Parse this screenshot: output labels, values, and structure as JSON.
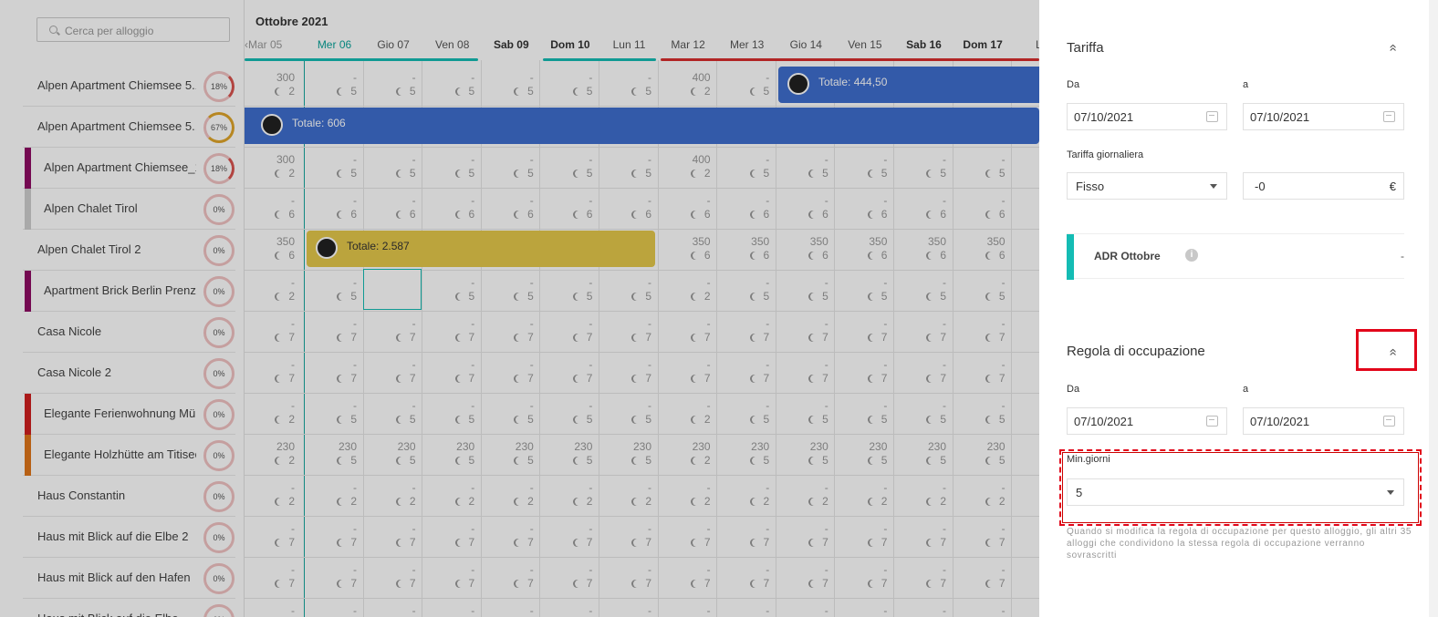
{
  "search": {
    "placeholder": "Cerca per alloggio"
  },
  "calendar": {
    "month": "Ottobre 2021",
    "prev_day": "Mar 05",
    "days": [
      "Mer 06",
      "Gio 07",
      "Ven 08",
      "Sab 09",
      "Dom 10",
      "Lun 11",
      "Mar 12",
      "Mer 13",
      "Gio 14",
      "Ven 15",
      "Sab 16",
      "Dom 17",
      "Lu"
    ]
  },
  "properties": [
    {
      "name": "Alpen Apartment Chiemsee 5.1",
      "pct": "18%",
      "color": ""
    },
    {
      "name": "Alpen Apartment Chiemsee 5...",
      "pct": "67%",
      "color": ""
    },
    {
      "name": "Alpen Apartment Chiemsee_1",
      "pct": "18%",
      "color": "#8e0b63"
    },
    {
      "name": "Alpen Chalet Tirol",
      "pct": "0%",
      "color": "#cfcfcf"
    },
    {
      "name": "Alpen Chalet Tirol 2",
      "pct": "0%",
      "color": ""
    },
    {
      "name": "Apartment Brick Berlin Prenzl...",
      "pct": "0%",
      "color": "#8e0b63"
    },
    {
      "name": "Casa Nicole",
      "pct": "0%",
      "color": ""
    },
    {
      "name": "Casa Nicole 2",
      "pct": "0%",
      "color": ""
    },
    {
      "name": "Elegante Ferienwohnung Mü...",
      "pct": "0%",
      "color": "#d01f1f"
    },
    {
      "name": "Elegante Holzhütte am Titisee",
      "pct": "0%",
      "color": "#e0761a"
    },
    {
      "name": "Haus Constantin",
      "pct": "0%",
      "color": ""
    },
    {
      "name": "Haus mit Blick auf die Elbe 2",
      "pct": "0%",
      "color": ""
    },
    {
      "name": "Haus mit Blick auf den Hafen",
      "pct": "0%",
      "color": ""
    },
    {
      "name": "Haus mit Blick auf die Elbe",
      "pct": "0%",
      "color": ""
    }
  ],
  "grid": [
    {
      "p": [
        "300",
        "-",
        "-",
        "-",
        "-",
        "-",
        "-",
        "400",
        "-"
      ],
      "m": [
        "2",
        "5",
        "5",
        "5",
        "5",
        "5",
        "5",
        "2",
        "5",
        "5",
        "5",
        "5",
        "5"
      ]
    },
    {
      "p": [],
      "m": []
    },
    {
      "p": [
        "300",
        "-",
        "-",
        "-",
        "-",
        "-",
        "-",
        "400",
        "-",
        "-",
        "-",
        "-",
        "-"
      ],
      "m": [
        "2",
        "5",
        "5",
        "5",
        "5",
        "5",
        "5",
        "2",
        "5",
        "5",
        "5",
        "5",
        "5"
      ]
    },
    {
      "p": [
        "-",
        "-",
        "-",
        "-",
        "-",
        "-",
        "-",
        "-",
        "-",
        "-",
        "-",
        "-",
        "-"
      ],
      "m": [
        "6",
        "6",
        "6",
        "6",
        "6",
        "6",
        "6",
        "6",
        "6",
        "6",
        "6",
        "6",
        "6"
      ]
    },
    {
      "p": [
        "350",
        "",
        "",
        "",
        "",
        "",
        "",
        "350",
        "350",
        "350",
        "350",
        "350",
        "350"
      ],
      "m": [
        "6",
        "",
        "",
        "",
        "",
        "",
        "",
        "6",
        "6",
        "6",
        "6",
        "6",
        "6"
      ]
    },
    {
      "p": [
        "-",
        "-",
        "-",
        "-",
        "-",
        "-",
        "-",
        "-",
        "-",
        "-",
        "-",
        "-",
        "-"
      ],
      "m": [
        "2",
        "5",
        "5",
        "5",
        "5",
        "5",
        "5",
        "2",
        "5",
        "5",
        "5",
        "5",
        "5"
      ]
    },
    {
      "p": [
        "-",
        "-",
        "-",
        "-",
        "-",
        "-",
        "-",
        "-",
        "-",
        "-",
        "-",
        "-",
        "-"
      ],
      "m": [
        "7",
        "7",
        "7",
        "7",
        "7",
        "7",
        "7",
        "7",
        "7",
        "7",
        "7",
        "7",
        "7"
      ]
    },
    {
      "p": [
        "-",
        "-",
        "-",
        "-",
        "-",
        "-",
        "-",
        "-",
        "-",
        "-",
        "-",
        "-",
        "-"
      ],
      "m": [
        "7",
        "7",
        "7",
        "7",
        "7",
        "7",
        "7",
        "7",
        "7",
        "7",
        "7",
        "7",
        "7"
      ]
    },
    {
      "p": [
        "-",
        "-",
        "-",
        "-",
        "-",
        "-",
        "-",
        "-",
        "-",
        "-",
        "-",
        "-",
        "-"
      ],
      "m": [
        "2",
        "5",
        "5",
        "5",
        "5",
        "5",
        "5",
        "2",
        "5",
        "5",
        "5",
        "5",
        "5"
      ]
    },
    {
      "p": [
        "230",
        "230",
        "230",
        "230",
        "230",
        "230",
        "230",
        "230",
        "230",
        "230",
        "230",
        "230",
        "230"
      ],
      "m": [
        "2",
        "5",
        "5",
        "5",
        "5",
        "5",
        "5",
        "2",
        "5",
        "5",
        "5",
        "5",
        "5"
      ]
    },
    {
      "p": [
        "-",
        "-",
        "-",
        "-",
        "-",
        "-",
        "-",
        "-",
        "-",
        "-",
        "-",
        "-",
        "-"
      ],
      "m": [
        "2",
        "2",
        "2",
        "2",
        "2",
        "2",
        "2",
        "2",
        "2",
        "2",
        "2",
        "2",
        "2"
      ]
    },
    {
      "p": [
        "-",
        "-",
        "-",
        "-",
        "-",
        "-",
        "-",
        "-",
        "-",
        "-",
        "-",
        "-",
        "-"
      ],
      "m": [
        "7",
        "7",
        "7",
        "7",
        "7",
        "7",
        "7",
        "7",
        "7",
        "7",
        "7",
        "7",
        "7"
      ]
    },
    {
      "p": [
        "-",
        "-",
        "-",
        "-",
        "-",
        "-",
        "-",
        "-",
        "-",
        "-",
        "-",
        "-",
        "-"
      ],
      "m": [
        "7",
        "7",
        "7",
        "7",
        "7",
        "7",
        "7",
        "7",
        "7",
        "7",
        "7",
        "7",
        "7"
      ]
    },
    {
      "p": [
        "-",
        "-",
        "-",
        "-",
        "-",
        "-",
        "-",
        "-",
        "-",
        "-",
        "-",
        "-",
        "-"
      ],
      "m": [
        "",
        "",
        "",
        "",
        "",
        "",
        "",
        "",
        "",
        "",
        "",
        "",
        ""
      ]
    }
  ],
  "bookings": {
    "b1": "Totale: 444,50",
    "b2": "Totale: 606",
    "b3": "Totale: 2.587"
  },
  "colors": {
    "booking_blue": "#3f6ecf",
    "booking_gold": "#e5c84b",
    "accent_teal": "#14bcb4",
    "highlight_red": "#e2061a"
  },
  "panel": {
    "tariffa": {
      "title": "Tariffa",
      "from_label": "Da",
      "to_label": "a",
      "from": "07/10/2021",
      "to": "07/10/2021",
      "daily_label": "Tariffa giornaliera",
      "type": "Fisso",
      "amount": "-0",
      "currency": "€"
    },
    "adr": {
      "label": "ADR Ottobre",
      "info": "i",
      "value": "-"
    },
    "occupazione": {
      "title": "Regola di occupazione",
      "from_label": "Da",
      "to_label": "a",
      "from": "07/10/2021",
      "to": "07/10/2021",
      "min_label": "Min.giorni",
      "min_value": "5",
      "note": "Quando si modifica la regola di occupazione per questo alloggio, gli altri 35 alloggi che condividono la stessa regola di occupazione verranno sovrascritti"
    },
    "chevron": "»"
  }
}
